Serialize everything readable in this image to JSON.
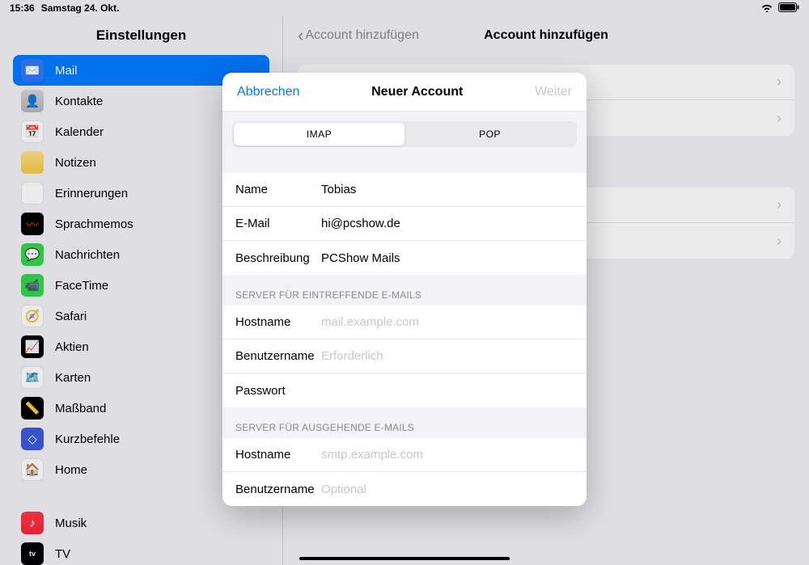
{
  "status": {
    "time": "15:36",
    "date": "Samstag 24. Okt."
  },
  "sidebar": {
    "title": "Einstellungen",
    "items": [
      {
        "label": "Mail",
        "icon": "mail"
      },
      {
        "label": "Kontakte",
        "icon": "contacts"
      },
      {
        "label": "Kalender",
        "icon": "cal"
      },
      {
        "label": "Notizen",
        "icon": "notes"
      },
      {
        "label": "Erinnerungen",
        "icon": "rem"
      },
      {
        "label": "Sprachmemos",
        "icon": "voice"
      },
      {
        "label": "Nachrichten",
        "icon": "msg"
      },
      {
        "label": "FaceTime",
        "icon": "ft"
      },
      {
        "label": "Safari",
        "icon": "safari"
      },
      {
        "label": "Aktien",
        "icon": "stocks"
      },
      {
        "label": "Karten",
        "icon": "maps"
      },
      {
        "label": "Maßband",
        "icon": "measure"
      },
      {
        "label": "Kurzbefehle",
        "icon": "sc"
      },
      {
        "label": "Home",
        "icon": "home"
      }
    ],
    "items2": [
      {
        "label": "Musik",
        "icon": "music"
      },
      {
        "label": "TV",
        "icon": "tv"
      }
    ]
  },
  "detail": {
    "back": "Account hinzufügen",
    "title": "Account hinzufügen"
  },
  "sheet": {
    "cancel": "Abbrechen",
    "title": "Neuer Account",
    "next": "Weiter",
    "seg": {
      "imap": "IMAP",
      "pop": "POP"
    },
    "fields": {
      "name_label": "Name",
      "name_value": "Tobias",
      "email_label": "E-Mail",
      "email_value": "hi@pcshow.de",
      "desc_label": "Beschreibung",
      "desc_value": "PCShow Mails"
    },
    "incoming_header": "SERVER FÜR EINTREFFENDE E-MAILS",
    "incoming": {
      "host_label": "Hostname",
      "host_ph": "mail.example.com",
      "user_label": "Benutzername",
      "user_ph": "Erforderlich",
      "pass_label": "Passwort"
    },
    "outgoing_header": "SERVER FÜR AUSGEHENDE E-MAILS",
    "outgoing": {
      "host_label": "Hostname",
      "host_ph": "smtp.example.com",
      "user_label": "Benutzername",
      "user_ph": "Optional"
    }
  }
}
